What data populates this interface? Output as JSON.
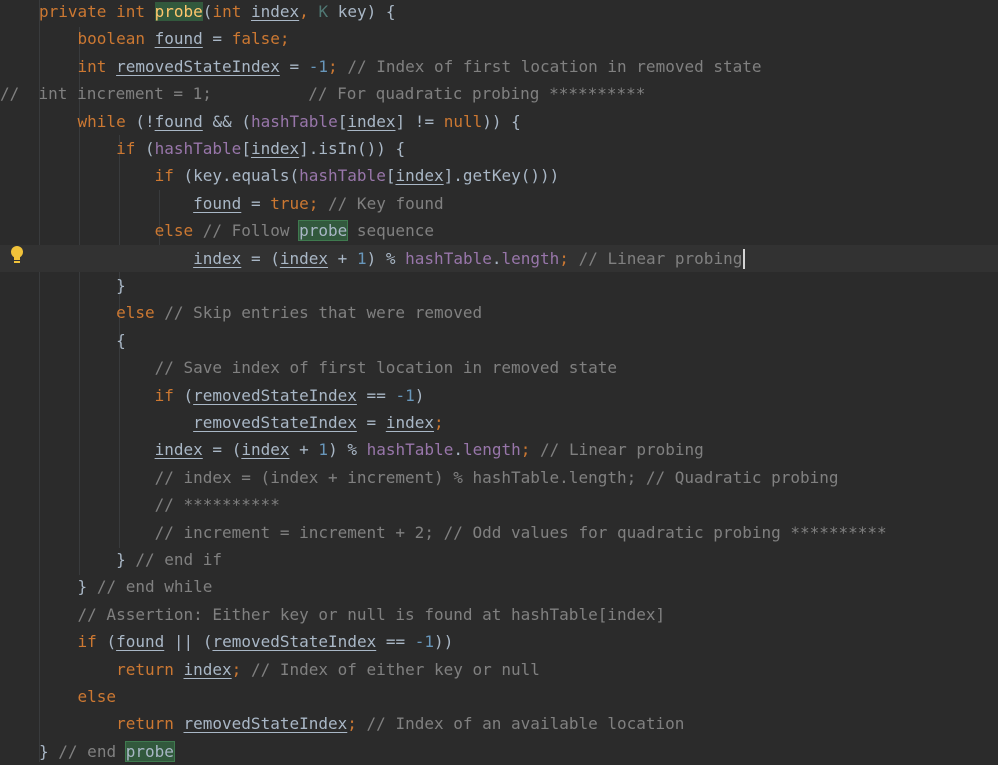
{
  "editor": {
    "lines": [
      "private int probe(int index, K key) {",
      "    boolean found = false;",
      "    int removedStateIndex = -1; // Index of first location in removed state",
      "//  int increment = 1;          // For quadratic probing **********",
      "    while (!found && (hashTable[index] != null)) {",
      "        if (hashTable[index].isIn()) {",
      "            if (key.equals(hashTable[index].getKey()))",
      "                found = true; // Key found",
      "            else // Follow probe sequence",
      "                index = (index + 1) % hashTable.length; // Linear probing",
      "        }",
      "        else // Skip entries that were removed",
      "        {",
      "            // Save index of first location in removed state",
      "            if (removedStateIndex == -1)",
      "                removedStateIndex = index;",
      "            index = (index + 1) % hashTable.length; // Linear probing",
      "            // index = (index + increment) % hashTable.length; // Quadratic probing",
      "            // **********",
      "            // increment = increment + 2; // Odd values for quadratic probing **********",
      "        } // end if",
      "    } // end while",
      "    // Assertion: Either key or null is found at hashTable[index]",
      "    if (found || (removedStateIndex == -1))",
      "        return index; // Index of either key or null",
      "    else",
      "        return removedStateIndex; // Index of an available location",
      "} // end probe"
    ],
    "current_line": 10,
    "intention_icon": "lightbulb-icon",
    "colors": {
      "background": "#2b2b2b",
      "keyword": "#cc7832",
      "comment": "#808080",
      "number": "#6897bb",
      "field": "#9876aa",
      "text": "#a9b7c6",
      "highlight": "#32593d"
    }
  }
}
